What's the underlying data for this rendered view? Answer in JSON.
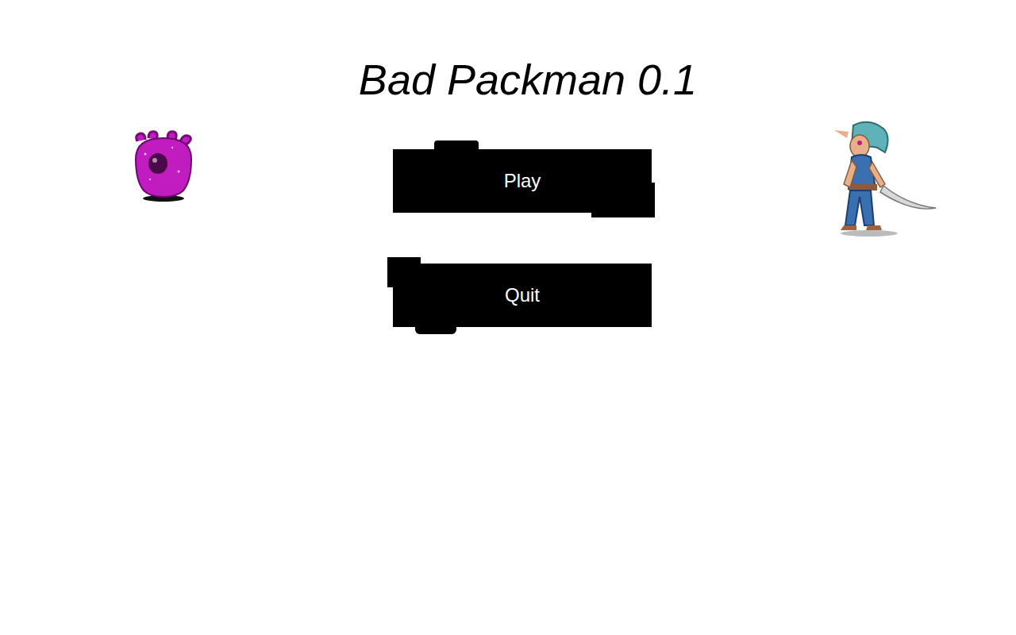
{
  "title": "Bad Packman 0.1",
  "buttons": [
    {
      "label": "Play"
    },
    {
      "label": "Quit"
    }
  ]
}
